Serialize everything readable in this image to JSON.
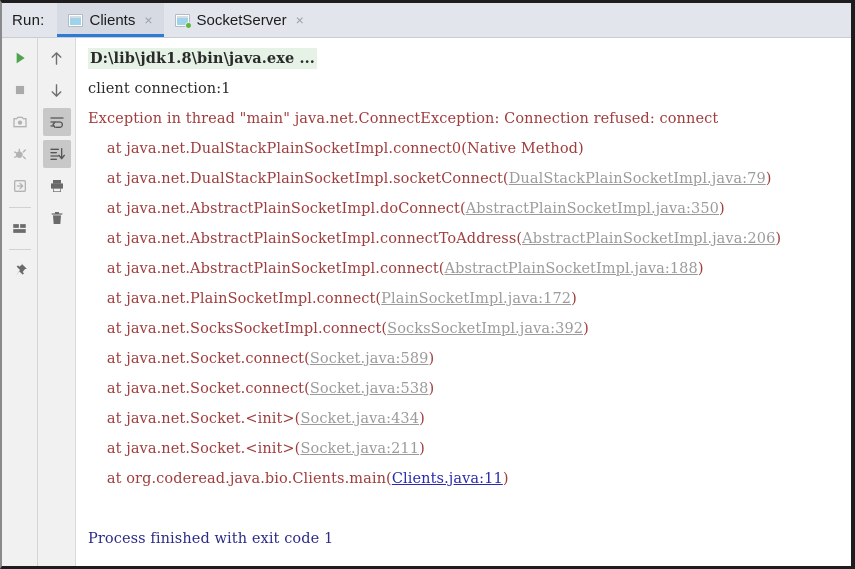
{
  "window": {
    "run_label": "Run:"
  },
  "tabs": [
    {
      "label": "Clients",
      "icon": "run-config-icon",
      "close_icon": "×",
      "active": true,
      "running": false
    },
    {
      "label": "SocketServer",
      "icon": "run-config-running-icon",
      "close_icon": "×",
      "active": false,
      "running": true
    }
  ],
  "toolbar_left": [
    {
      "name": "rerun-button",
      "icon": "play-icon",
      "toggled": false
    },
    {
      "name": "stop-button",
      "icon": "stop-icon",
      "toggled": false
    },
    {
      "name": "screenshot-button",
      "icon": "camera-icon",
      "toggled": false
    },
    {
      "name": "debug-button",
      "icon": "bug-icon",
      "toggled": false
    },
    {
      "name": "attach-process-button",
      "icon": "import-icon",
      "toggled": false
    },
    {
      "name": "separator",
      "icon": "separator",
      "toggled": false
    },
    {
      "name": "layout-settings-button",
      "icon": "layout-icon",
      "toggled": false
    },
    {
      "name": "separator",
      "icon": "separator",
      "toggled": false
    },
    {
      "name": "pin-tab-button",
      "icon": "pin-icon",
      "toggled": false
    }
  ],
  "toolbar_right": [
    {
      "name": "up-the-stack-trace-button",
      "icon": "arrow-up-icon",
      "toggled": false
    },
    {
      "name": "down-the-stack-trace-button",
      "icon": "arrow-down-icon",
      "toggled": false
    },
    {
      "name": "soft-wrap-button",
      "icon": "soft-wrap-icon",
      "toggled": true
    },
    {
      "name": "scroll-to-end-button",
      "icon": "scroll-to-end-icon",
      "toggled": true
    },
    {
      "name": "print-button",
      "icon": "printer-icon",
      "toggled": false
    },
    {
      "name": "clear-all-button",
      "icon": "trash-icon",
      "toggled": false
    }
  ],
  "colors": {
    "tabbar_bg": "#e2e5ec",
    "active_tab_underline": "#2e7bd6",
    "running_dot": "#5fb83d",
    "stacktrace_text": "#a03c3c",
    "command_highlight": "#e6f2e6",
    "jdk_link": "#9b9b9b",
    "user_link": "#2a2ab0",
    "exit_code_text": "#2b2b87"
  },
  "console": {
    "lines": [
      {
        "kind": "command",
        "text": "D:\\lib\\jdk1.8\\bin\\java.exe ..."
      },
      {
        "kind": "plain",
        "text": "client connection:1"
      },
      {
        "kind": "stack",
        "text": "Exception in thread \"main\" java.net.ConnectException: Connection refused: connect",
        "link": null
      },
      {
        "kind": "stack",
        "text": "    at java.net.DualStackPlainSocketImpl.connect0(Native Method)",
        "link": null
      },
      {
        "kind": "stack",
        "prefix": "    at java.net.DualStackPlainSocketImpl.socketConnect(",
        "link": "DualStackPlainSocketImpl.java:79",
        "link_kind": "jdk",
        "suffix": ")"
      },
      {
        "kind": "stack",
        "prefix": "    at java.net.AbstractPlainSocketImpl.doConnect(",
        "link": "AbstractPlainSocketImpl.java:350",
        "link_kind": "jdk",
        "suffix": ")"
      },
      {
        "kind": "stack",
        "prefix": "    at java.net.AbstractPlainSocketImpl.connectToAddress(",
        "link": "AbstractPlainSocketImpl.java:206",
        "link_kind": "jdk",
        "suffix": ")"
      },
      {
        "kind": "stack",
        "prefix": "    at java.net.AbstractPlainSocketImpl.connect(",
        "link": "AbstractPlainSocketImpl.java:188",
        "link_kind": "jdk",
        "suffix": ")"
      },
      {
        "kind": "stack",
        "prefix": "    at java.net.PlainSocketImpl.connect(",
        "link": "PlainSocketImpl.java:172",
        "link_kind": "jdk",
        "suffix": ")"
      },
      {
        "kind": "stack",
        "prefix": "    at java.net.SocksSocketImpl.connect(",
        "link": "SocksSocketImpl.java:392",
        "link_kind": "jdk",
        "suffix": ")"
      },
      {
        "kind": "stack",
        "prefix": "    at java.net.Socket.connect(",
        "link": "Socket.java:589",
        "link_kind": "jdk",
        "suffix": ")"
      },
      {
        "kind": "stack",
        "prefix": "    at java.net.Socket.connect(",
        "link": "Socket.java:538",
        "link_kind": "jdk",
        "suffix": ")"
      },
      {
        "kind": "stack",
        "prefix": "    at java.net.Socket.<init>(",
        "link": "Socket.java:434",
        "link_kind": "jdk",
        "suffix": ")"
      },
      {
        "kind": "stack",
        "prefix": "    at java.net.Socket.<init>(",
        "link": "Socket.java:211",
        "link_kind": "jdk",
        "suffix": ")"
      },
      {
        "kind": "stack",
        "prefix": "    at org.coderead.java.bio.Clients.main(",
        "link": "Clients.java:11",
        "link_kind": "user",
        "suffix": ")"
      },
      {
        "kind": "blank",
        "text": " "
      },
      {
        "kind": "exit",
        "text": "Process finished with exit code 1"
      }
    ]
  }
}
